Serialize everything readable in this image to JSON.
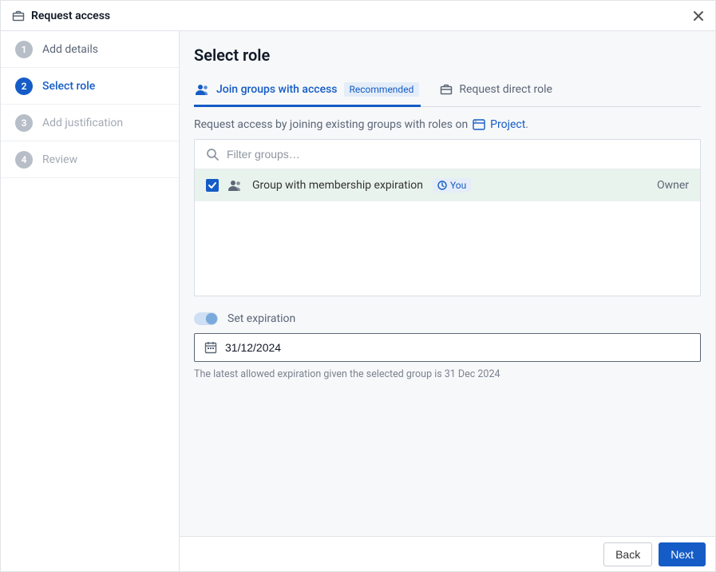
{
  "header": {
    "title": "Request access"
  },
  "steps": [
    {
      "num": "1",
      "label": "Add details"
    },
    {
      "num": "2",
      "label": "Select role"
    },
    {
      "num": "3",
      "label": "Add justification"
    },
    {
      "num": "4",
      "label": "Review"
    }
  ],
  "main": {
    "heading": "Select role",
    "tabs": {
      "join": {
        "label": "Join groups with access",
        "badge": "Recommended"
      },
      "direct": {
        "label": "Request direct role"
      }
    },
    "description_prefix": "Request access by joining existing groups with roles on",
    "project_link": "Project",
    "description_suffix": ".",
    "filter_placeholder": "Filter groups…",
    "group": {
      "name": "Group with membership expiration",
      "you_badge": "You",
      "role": "Owner"
    },
    "set_expiration_label": "Set expiration",
    "date_value": "31/12/2024",
    "hint": "The latest allowed expiration given the selected group is 31 Dec 2024"
  },
  "footer": {
    "back": "Back",
    "next": "Next"
  }
}
